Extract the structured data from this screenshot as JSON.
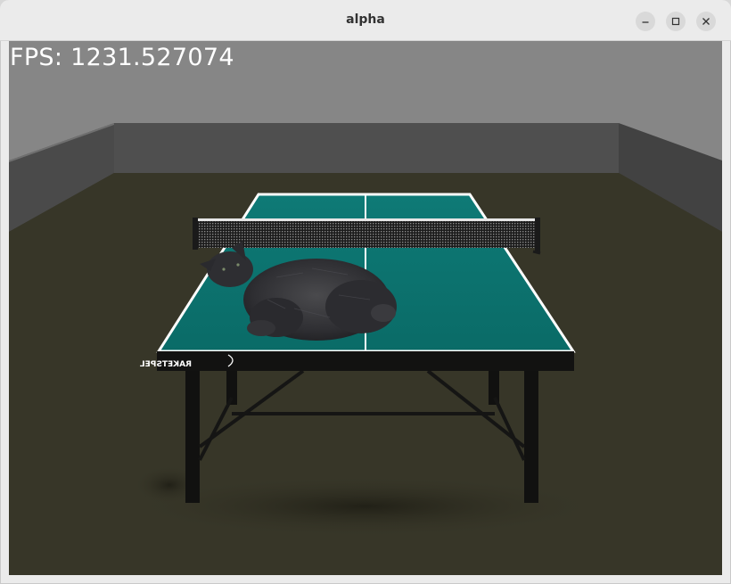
{
  "window": {
    "title": "alpha",
    "controls": {
      "minimize_icon": "minimize-icon",
      "maximize_icon": "maximize-icon",
      "close_icon": "close-icon"
    }
  },
  "overlay": {
    "fps_text": "FPS: 1231.527074"
  },
  "scene": {
    "table_brand": "RAKETSPEL",
    "colors": {
      "table_surface": "#0d7773",
      "floor": "#373628",
      "back_wall": "#4d4d4d",
      "side_wall": "#3f3f3f",
      "ceiling": "#868686"
    }
  }
}
